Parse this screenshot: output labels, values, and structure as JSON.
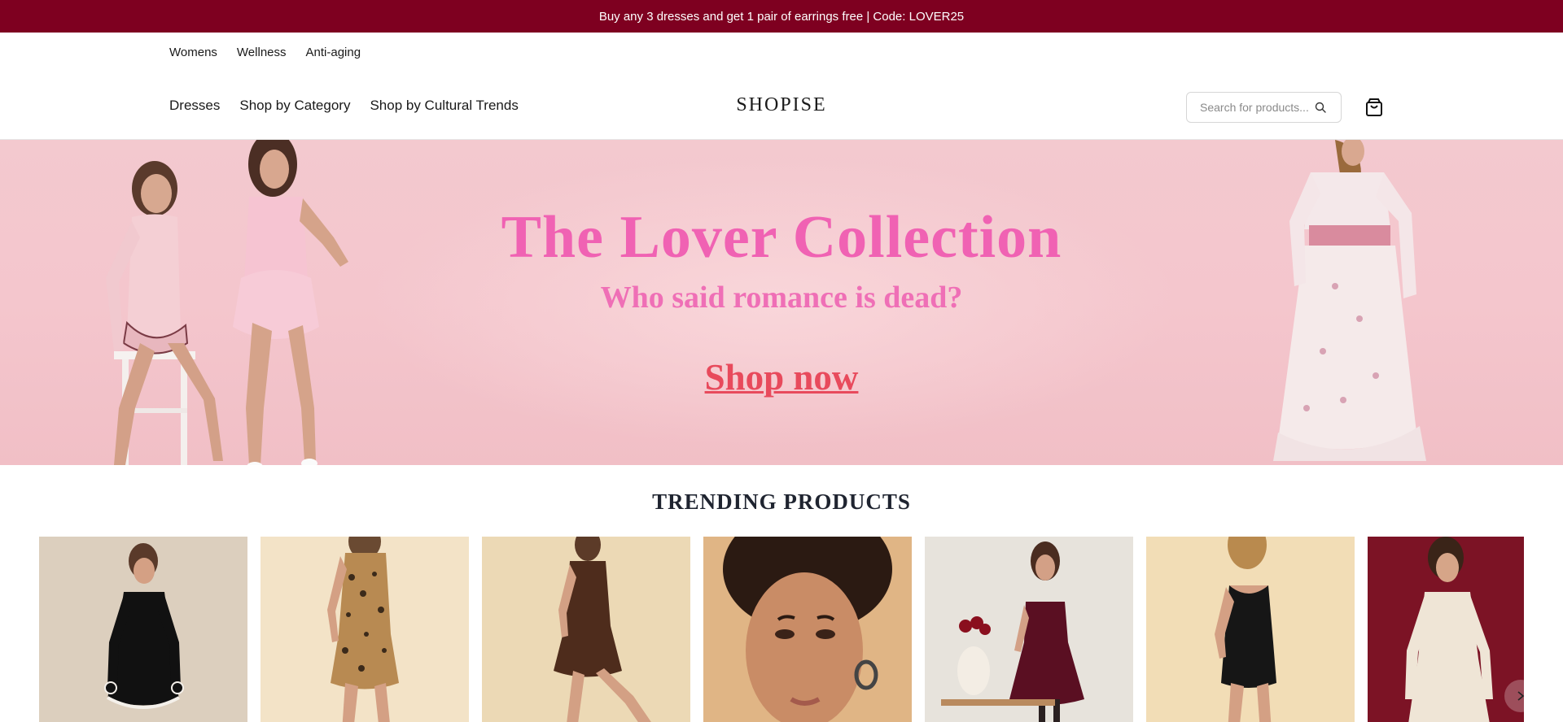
{
  "announcement": {
    "text": "Buy any 3 dresses and get 1 pair of earrings free | Code: LOVER25"
  },
  "top_nav": [
    {
      "label": "Womens"
    },
    {
      "label": "Wellness"
    },
    {
      "label": "Anti-aging"
    }
  ],
  "main_nav": [
    {
      "label": "Dresses"
    },
    {
      "label": "Shop by Category"
    },
    {
      "label": "Shop by Cultural Trends"
    }
  ],
  "logo": {
    "text": "SHOPISE"
  },
  "search": {
    "placeholder": "Search for products...",
    "icon": "search-icon"
  },
  "cart": {
    "icon": "shopping-bag-icon"
  },
  "hero": {
    "title": "The Lover Collection",
    "subtitle": "Who said romance is dead?",
    "cta": "Shop now"
  },
  "trending": {
    "title": "TRENDING PRODUCTS",
    "products": [
      {
        "image": "black-long-sleeve-ruffle-mini-dress"
      },
      {
        "image": "leopard-print-mini-dress"
      },
      {
        "image": "brown-sleeveless-mini-dress"
      },
      {
        "image": "woman-portrait-hoop-earrings"
      },
      {
        "image": "burgundy-velvet-strapless-dress"
      },
      {
        "image": "black-bodycon-mini-dress"
      },
      {
        "image": "cream-long-sleeve-mini-dress"
      }
    ],
    "next_icon": "chevron-right-icon"
  },
  "colors": {
    "announcement_bg": "#7e0020",
    "hero_bg": "#f3c9cf",
    "hero_title": "#f062b3",
    "hero_cta": "#e84a5c"
  }
}
